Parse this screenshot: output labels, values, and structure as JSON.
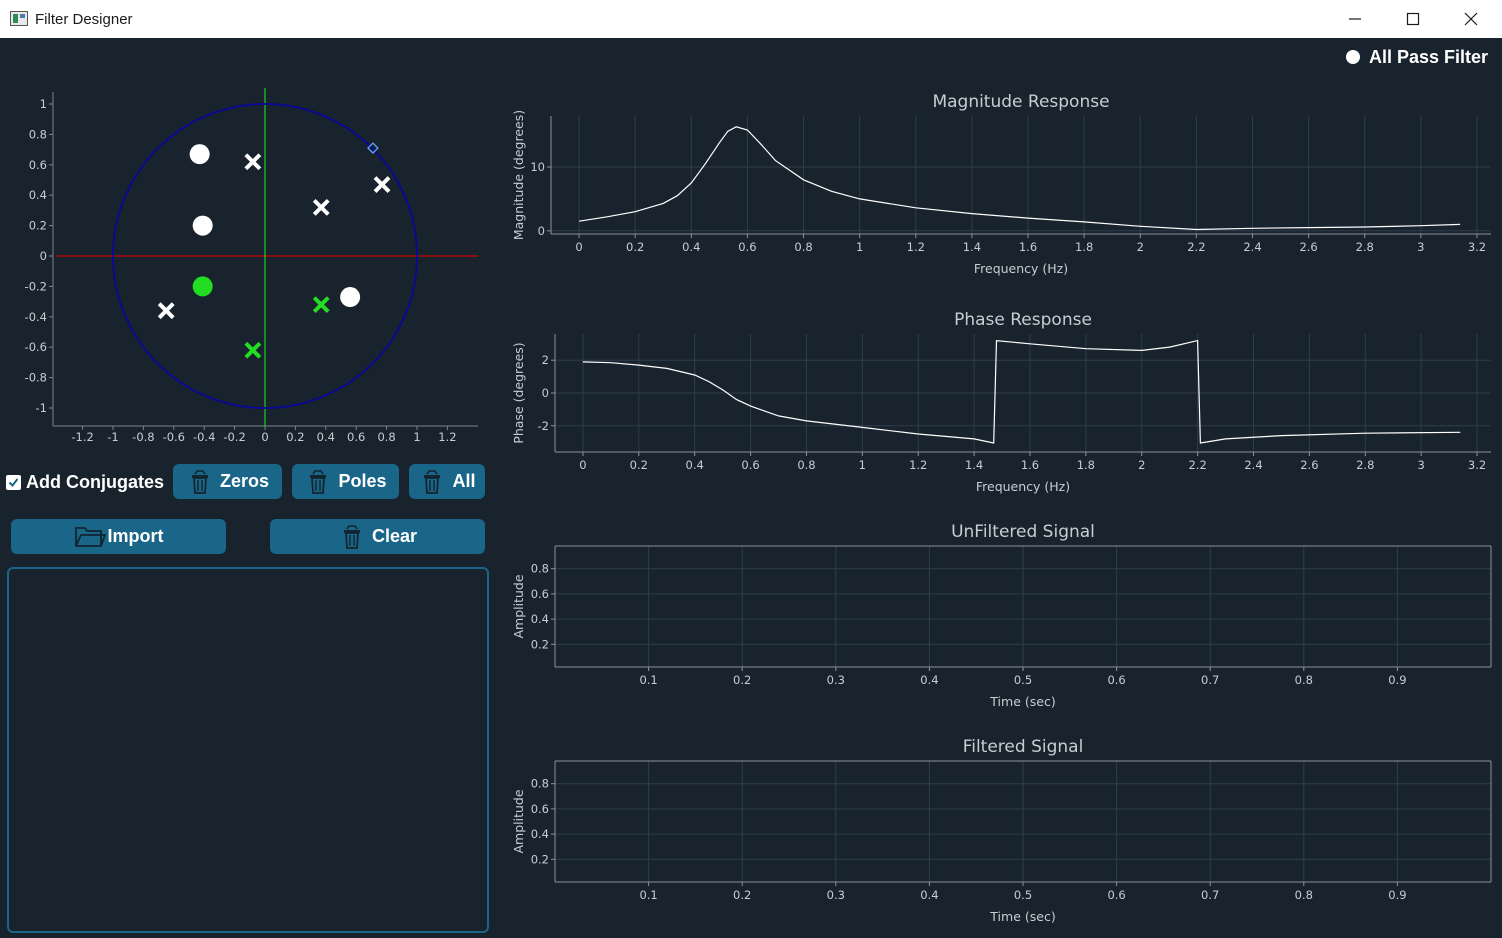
{
  "window": {
    "title": "Filter Designer",
    "controls": [
      "minimize-icon",
      "maximize-icon",
      "close-icon"
    ]
  },
  "all_pass": {
    "label": "All Pass Filter",
    "checked": false
  },
  "pole_zero_plot": {
    "x_ticks": [
      "-1.2",
      "-1",
      "-0.8",
      "-0.6",
      "-0.4",
      "-0.2",
      "0",
      "0.2",
      "0.4",
      "0.6",
      "0.8",
      "1",
      "1.2"
    ],
    "y_ticks": [
      "1",
      "0.8",
      "0.6",
      "0.4",
      "0.2",
      "0",
      "-0.2",
      "-0.4",
      "-0.6",
      "-0.8",
      "-1"
    ],
    "zeros": [
      {
        "x": -0.43,
        "y": 0.67,
        "selected": false
      },
      {
        "x": -0.41,
        "y": 0.2,
        "selected": false
      },
      {
        "x": -0.41,
        "y": -0.2,
        "selected": true
      },
      {
        "x": 0.56,
        "y": -0.27,
        "selected": false
      }
    ],
    "poles": [
      {
        "x": -0.08,
        "y": 0.62,
        "selected": false
      },
      {
        "x": 0.77,
        "y": 0.47,
        "selected": false
      },
      {
        "x": 0.37,
        "y": 0.32,
        "selected": false
      },
      {
        "x": -0.65,
        "y": -0.36,
        "selected": false
      },
      {
        "x": 0.37,
        "y": -0.32,
        "selected": true
      },
      {
        "x": -0.08,
        "y": -0.62,
        "selected": true
      }
    ],
    "marker": {
      "x": 0.71,
      "y": 0.71
    },
    "colors": {
      "unit_circle": "#0a0a90",
      "real_axis": "#cc0000",
      "imag_axis": "#22cc22",
      "selected": "#22dd22"
    }
  },
  "controls": {
    "add_conjugates": {
      "label": "Add Conjugates",
      "checked": true
    },
    "zeros_button": "Zeros",
    "poles_button": "Poles",
    "all_button": "All",
    "import_button": "Import",
    "clear_button": "Clear"
  },
  "chart_data": [
    {
      "type": "line",
      "title": "Magnitude Response",
      "xlabel": "Frequency (Hz)",
      "ylabel": "Magnitude (degrees)",
      "xlim": [
        -0.1,
        3.25
      ],
      "ylim": [
        -0.5,
        18
      ],
      "x_ticks": [
        0,
        0.2,
        0.4,
        0.6,
        0.8,
        1,
        1.2,
        1.4,
        1.6,
        1.8,
        2,
        2.2,
        2.4,
        2.6,
        2.8,
        3,
        3.2
      ],
      "y_ticks": [
        0,
        10
      ],
      "x": [
        0,
        0.1,
        0.2,
        0.3,
        0.35,
        0.4,
        0.45,
        0.5,
        0.53,
        0.56,
        0.6,
        0.65,
        0.7,
        0.8,
        0.9,
        1,
        1.2,
        1.4,
        1.6,
        1.8,
        2,
        2.2,
        2.4,
        2.6,
        2.8,
        3,
        3.14
      ],
      "y": [
        1.5,
        2.2,
        3,
        4.3,
        5.5,
        7.5,
        10.5,
        13.8,
        15.6,
        16.3,
        15.8,
        13.5,
        11,
        8,
        6.2,
        5,
        3.6,
        2.7,
        2,
        1.4,
        0.7,
        0.2,
        0.4,
        0.5,
        0.6,
        0.8,
        1
      ]
    },
    {
      "type": "line",
      "title": "Phase Response",
      "xlabel": "Frequency (Hz)",
      "ylabel": "Phase (degrees)",
      "xlim": [
        -0.1,
        3.25
      ],
      "ylim": [
        -3.6,
        3.6
      ],
      "x_ticks": [
        0,
        0.2,
        0.4,
        0.6,
        0.8,
        1,
        1.2,
        1.4,
        1.6,
        1.8,
        2,
        2.2,
        2.4,
        2.6,
        2.8,
        3,
        3.2
      ],
      "y_ticks": [
        2,
        0,
        -2
      ],
      "x": [
        0,
        0.1,
        0.2,
        0.3,
        0.4,
        0.45,
        0.5,
        0.55,
        0.6,
        0.7,
        0.8,
        1,
        1.2,
        1.4,
        1.47,
        1.48,
        1.6,
        1.8,
        2,
        2.1,
        2.2,
        2.21,
        2.3,
        2.5,
        2.8,
        3.14
      ],
      "y": [
        1.9,
        1.85,
        1.7,
        1.5,
        1.1,
        0.7,
        0.2,
        -0.4,
        -0.8,
        -1.4,
        -1.7,
        -2.1,
        -2.5,
        -2.8,
        -3.05,
        3.2,
        3.0,
        2.7,
        2.6,
        2.8,
        3.2,
        -3.05,
        -2.8,
        -2.6,
        -2.45,
        -2.4
      ]
    },
    {
      "type": "line",
      "title": "UnFiltered Signal",
      "xlabel": "Time (sec)",
      "ylabel": "Amplitude",
      "xlim": [
        0,
        1
      ],
      "ylim": [
        0.02,
        0.98
      ],
      "x_ticks": [
        0.1,
        0.2,
        0.3,
        0.4,
        0.5,
        0.6,
        0.7,
        0.8,
        0.9
      ],
      "y_ticks": [
        0.2,
        0.4,
        0.6,
        0.8
      ],
      "x": [],
      "y": []
    },
    {
      "type": "line",
      "title": "Filtered Signal",
      "xlabel": "Time (sec)",
      "ylabel": "Amplitude",
      "xlim": [
        0,
        1
      ],
      "ylim": [
        0.02,
        0.98
      ],
      "x_ticks": [
        0.1,
        0.2,
        0.3,
        0.4,
        0.5,
        0.6,
        0.7,
        0.8,
        0.9
      ],
      "y_ticks": [
        0.2,
        0.4,
        0.6,
        0.8
      ],
      "x": [],
      "y": []
    }
  ]
}
